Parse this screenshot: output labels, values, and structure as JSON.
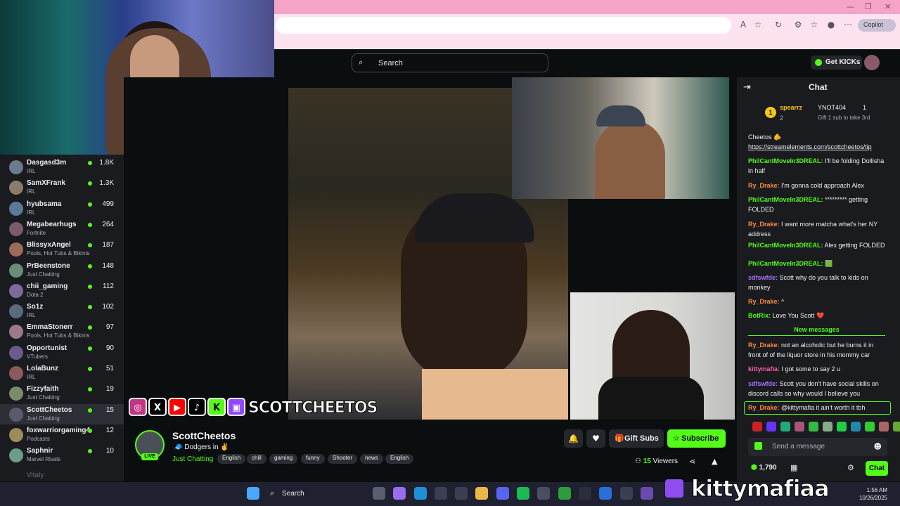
{
  "browser": {
    "copilot_label": "Copilot",
    "window_controls": [
      "—",
      "❐",
      "✕"
    ]
  },
  "header": {
    "search_placeholder": "Search",
    "get_kicks_label": "Get KICKs"
  },
  "sidebar": {
    "channels": [
      {
        "name": "Dasgasd3m",
        "category": "IRL",
        "viewers": "1.8K"
      },
      {
        "name": "SamXFrank",
        "category": "IRL",
        "viewers": "1.3K"
      },
      {
        "name": "hyubsama",
        "category": "IRL",
        "viewers": "499"
      },
      {
        "name": "Megabearhugs",
        "category": "Fortnite",
        "viewers": "264"
      },
      {
        "name": "BlissyxAngel",
        "category": "Pools, Hot Tubs & Bikinis",
        "viewers": "187"
      },
      {
        "name": "PrBeenstone",
        "category": "Just Chatting",
        "viewers": "148"
      },
      {
        "name": "chii_gaming",
        "category": "Dota 2",
        "viewers": "112"
      },
      {
        "name": "So1z",
        "category": "IRL",
        "viewers": "102"
      },
      {
        "name": "EmmaStonerr",
        "category": "Pools, Hot Tubs & Bikinis",
        "viewers": "97"
      },
      {
        "name": "Opportunist",
        "category": "VTubers",
        "viewers": "90"
      },
      {
        "name": "LolaBunz",
        "category": "IRL",
        "viewers": "51"
      },
      {
        "name": "Fizzyfaith",
        "category": "Just Chatting",
        "viewers": "19"
      },
      {
        "name": "ScottCheetos",
        "category": "Just Chatting",
        "viewers": "15"
      },
      {
        "name": "foxwarriorgaming4",
        "category": "Podcasts",
        "viewers": "12"
      },
      {
        "name": "Saphnir",
        "category": "Marvel Rivals",
        "viewers": "10"
      }
    ],
    "faded_name": "Vitaly"
  },
  "overlay": {
    "social_handle": "SCOTTCHEETOS",
    "kitty_name": "kittymafiaa"
  },
  "stream": {
    "channel_name": "ScottCheetos",
    "title": "🧢 Dodgers in ✌️",
    "category": "Just Chatting",
    "tags": [
      "English",
      "chill",
      "gaming",
      "funny",
      "Shooter",
      "news",
      "English"
    ],
    "live_label": "LIVE",
    "gift_subs_label": "Gift Subs",
    "subscribe_label": "Subscribe",
    "viewers_count": "15",
    "viewers_label": "Viewers"
  },
  "chat": {
    "title": "Chat",
    "leaderboard": {
      "first_name": "spearrz",
      "first_count": "2",
      "second_name": "YNOT404",
      "second_count": "1",
      "gift_text": "Gift 1 sub to take 3rd"
    },
    "messages": [
      {
        "user": "",
        "text": "Cheetos 🫵",
        "color": "#efeff1"
      },
      {
        "user": "",
        "text": "https://streamelements.com/scottcheetos/tip",
        "color": "#efeff1"
      },
      {
        "user": "PhilCantMoveIn3DREAL:",
        "text": " I'll be folding Dollisha in half",
        "color": "#53fc18"
      },
      {
        "user": "Ry_Drake:",
        "text": " I'm gonna cold approach Alex",
        "color": "#ff8a3c"
      },
      {
        "user": "PhilCantMoveIn3DREAL:",
        "text": " ********* getting FOLDED",
        "color": "#53fc18"
      },
      {
        "user": "Ry_Drake:",
        "text": " I want more matcha what's her NY address",
        "color": "#ff8a3c"
      },
      {
        "user": "PhilCantMoveIn3DREAL:",
        "text": " Alex getting FOLDED",
        "color": "#53fc18"
      },
      {
        "user": "PhilCantMoveIn3DREAL:",
        "text": " 🟩",
        "color": "#53fc18"
      },
      {
        "user": "sdfswfde:",
        "text": " Scott why do you talk to kids on monkey",
        "color": "#a970ff"
      },
      {
        "user": "Ry_Drake:",
        "text": " ^",
        "color": "#ff8a3c"
      },
      {
        "user": "BotRix:",
        "text": " Love You Scott ❤️",
        "color": "#53fc18"
      }
    ],
    "new_messages_label": "New messages",
    "new_messages": [
      {
        "user": "Ry_Drake:",
        "text": " not an alcoholic but he bums it in front of of the liquor store in his mommy car",
        "color": "#ff8a3c"
      },
      {
        "user": "kittymafia:",
        "text": " I got some to say 2 u",
        "color": "#ff5ea8"
      },
      {
        "user": "sdfswfde:",
        "text": " Scott you don't have social skills on discord calls so why would I believe you",
        "color": "#a970ff"
      },
      {
        "user": "Ry_Drake:",
        "text": " @kittymafia it ain't worth it tbh",
        "color": "#ff8a3c"
      }
    ],
    "send_placeholder": "Send a message",
    "points": "1,790",
    "chat_button_label": "Chat"
  },
  "taskbar": {
    "search_label": "Search",
    "time": "1:56 AM",
    "date": "10/26/2025"
  }
}
